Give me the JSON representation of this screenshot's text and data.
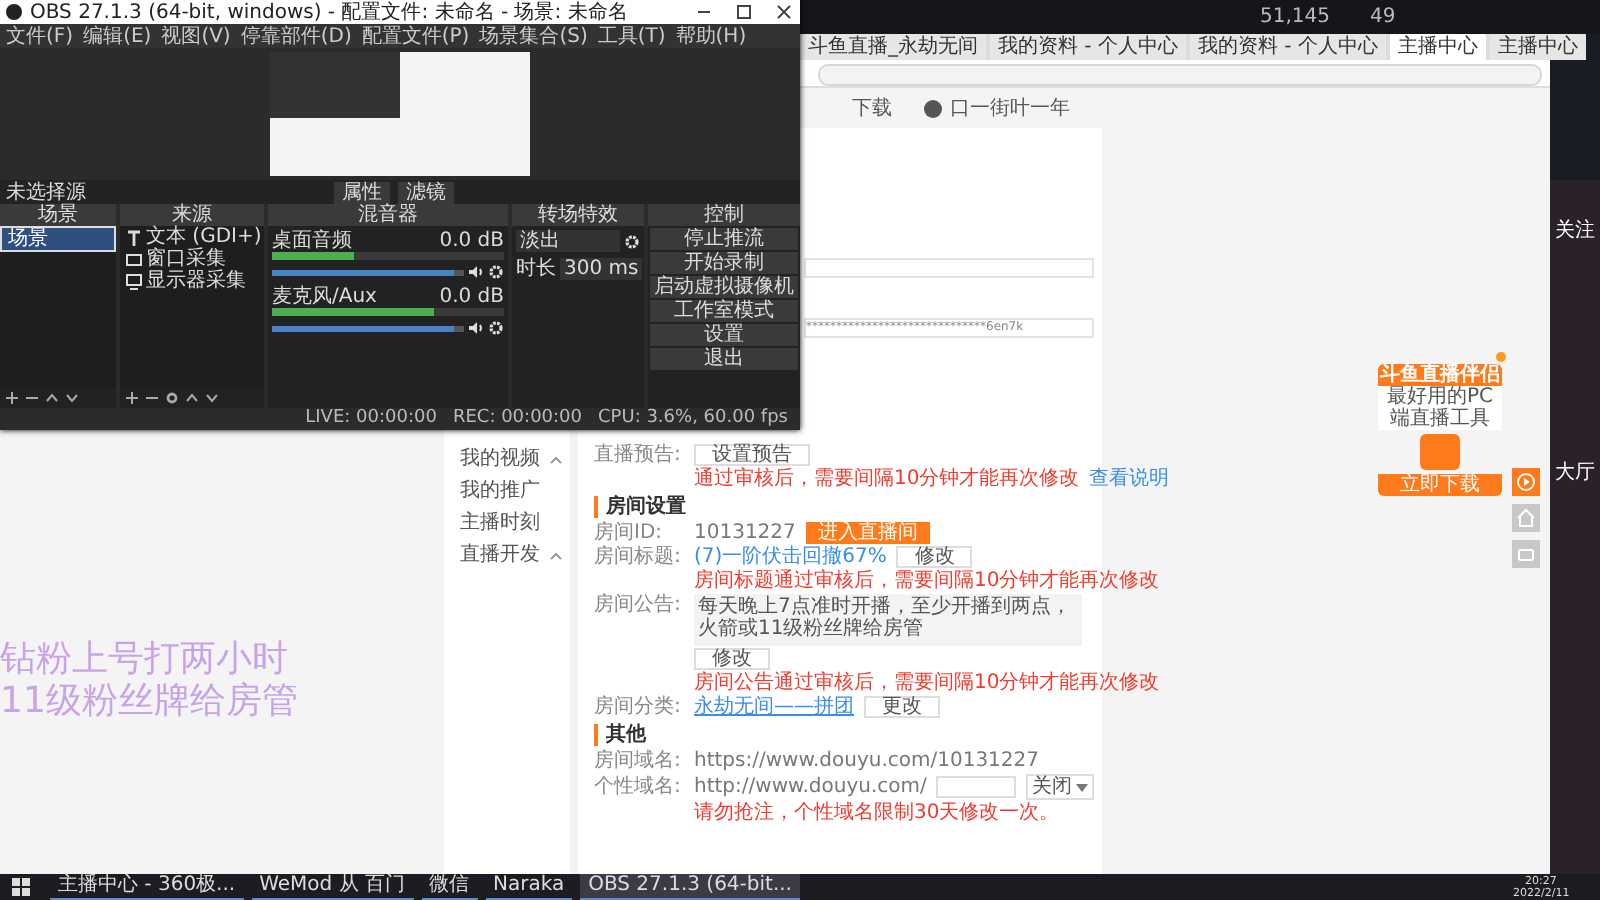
{
  "desktop": {
    "top_stats": [
      "51,145",
      "49"
    ],
    "side_labels": [
      "关注",
      "大厅"
    ]
  },
  "browser": {
    "tabs": [
      {
        "label": "斗鱼直播_永劫无间",
        "selected": false
      },
      {
        "label": "我的资料 - 个人中心",
        "selected": false
      },
      {
        "label": "我的资料 - 个人中心",
        "selected": false
      },
      {
        "label": "主播中心",
        "selected": true
      },
      {
        "label": "主播中心",
        "selected": false
      }
    ],
    "download": "下载",
    "user": "口一街叶一年"
  },
  "overlay": [
    "钻粉上号打两小时",
    "11级粉丝牌给房管"
  ],
  "sidebar": [
    {
      "label": "我的视频",
      "kind": "group"
    },
    {
      "label": "我的推广",
      "kind": "link"
    },
    {
      "label": "主播时刻",
      "kind": "link"
    },
    {
      "label": "直播开发",
      "kind": "group"
    }
  ],
  "card": {
    "masked_value": "******************************6en7k",
    "preview": {
      "label": "直播预告:",
      "button": "设置预告",
      "note": "通过审核后，需要间隔10分钟才能再次修改",
      "link": "查看说明"
    },
    "room": {
      "heading": "房间设置",
      "id_label": "房间ID:",
      "id": "10131227",
      "enter": "进入直播间",
      "title_label": "房间标题:",
      "title": "(7)一阶伏击回撤67%",
      "title_button": "修改",
      "title_note": "房间标题通过审核后，需要间隔10分钟才能再次修改",
      "notice_label": "房间公告:",
      "notice": "每天晚上7点准时开播，至少开播到两点，火箭或11级粉丝牌给房管",
      "notice_button": "修改",
      "notice_note": "房间公告通过审核后，需要间隔10分钟才能再次修改",
      "category_label": "房间分类:",
      "category": "永劫无间——拼团",
      "category_button": "更改"
    },
    "other": {
      "heading": "其他",
      "domain_label": "房间域名:",
      "domain": "https://www.douyu.com/10131227",
      "custom_label": "个性域名:",
      "custom_prefix": "http://www.douyu.com/",
      "custom_select": "关闭",
      "custom_note": "请勿抢注，个性域名限制30天修改一次。"
    }
  },
  "ad": {
    "title": "斗鱼直播伴侣",
    "subtitle": "最好用的PC端直播工具",
    "button": "立即下载"
  },
  "obs": {
    "title": "OBS 27.1.3 (64-bit, windows) - 配置文件: 未命名 - 场景: 未命名",
    "menu": [
      "文件(F)",
      "编辑(E)",
      "视图(V)",
      "停靠部件(D)",
      "配置文件(P)",
      "场景集合(S)",
      "工具(T)",
      "帮助(H)"
    ],
    "no_source": "未选择源",
    "source_buttons": [
      "属性",
      "滤镜"
    ],
    "scenes": {
      "header": "场景",
      "items": [
        {
          "label": "场景",
          "selected": true
        }
      ]
    },
    "sources": {
      "header": "来源",
      "items": [
        {
          "kind": "text",
          "label": "文本 (GDI+)"
        },
        {
          "kind": "window",
          "label": "窗口采集"
        },
        {
          "kind": "display",
          "label": "显示器采集"
        }
      ]
    },
    "mixer": {
      "header": "混音器",
      "channels": [
        {
          "name": "桌面音频",
          "reading": "0.0 dB",
          "meter": {
            "level": 0.35
          },
          "volume": {
            "level": 0.95
          }
        },
        {
          "name": "麦克风/Aux",
          "reading": "0.0 dB",
          "meter": {
            "level": 0.7
          },
          "volume": {
            "level": 0.95
          }
        }
      ]
    },
    "transitions": {
      "header": "转场特效",
      "type": "淡出",
      "duration_label": "时长",
      "duration": "300 ms"
    },
    "controls": {
      "header": "控制",
      "buttons": [
        "停止推流",
        "开始录制",
        "启动虚拟摄像机",
        "工作室模式",
        "设置",
        "退出"
      ]
    },
    "status": [
      "LIVE: 00:00:00",
      "REC: 00:00:00",
      "CPU: 3.6%, 60.00 fps"
    ]
  },
  "taskbar": {
    "apps": [
      {
        "label": "主播中心 - 360极...",
        "active": false
      },
      {
        "label": "WeMod 从 百门",
        "active": false
      },
      {
        "label": "微信",
        "active": false
      },
      {
        "label": "Naraka",
        "active": false
      },
      {
        "label": "OBS 27.1.3 (64-bit...",
        "active": true
      }
    ],
    "time": "20:27",
    "date": "2022/2/11"
  }
}
